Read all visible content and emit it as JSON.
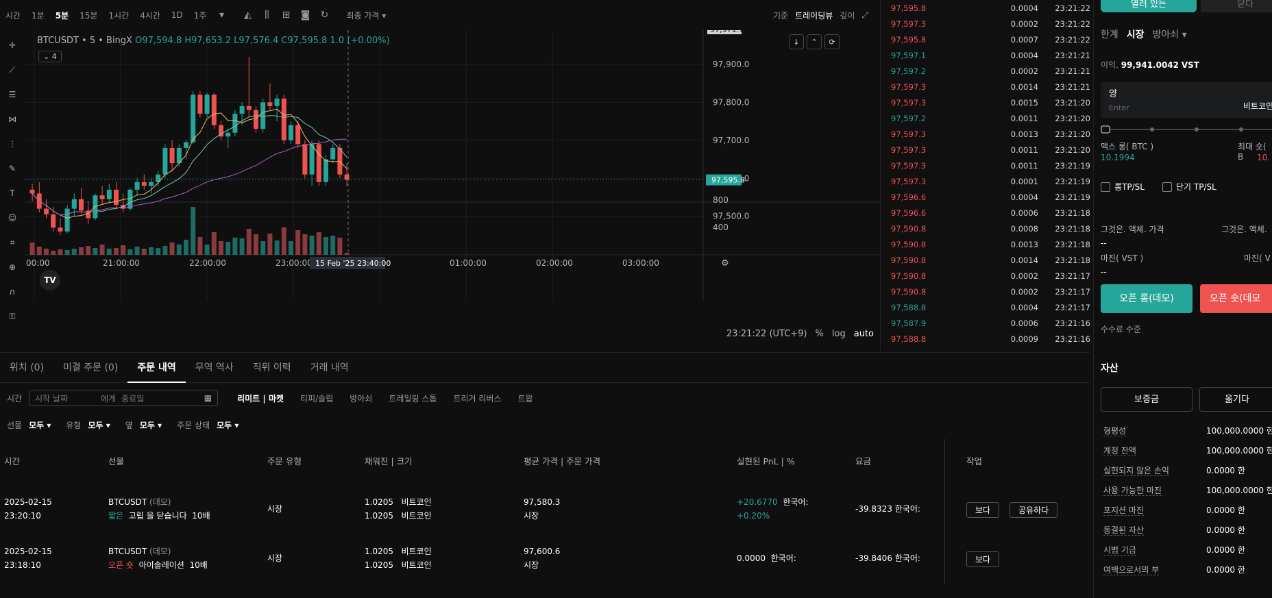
{
  "toolbar": {
    "intervals": [
      "시간",
      "1분",
      "5분",
      "15분",
      "1시간",
      "4시간",
      "1D",
      "1주"
    ],
    "active_interval": "5분",
    "price_type": "최종 가격 ▾",
    "basis_label": "기준",
    "view_tradingview": "트레이딩뷰",
    "view_depth": "깊이"
  },
  "legend": {
    "symbol": "BTCUSDT • 5 • BingX",
    "ohlc": "O97,594.8  H97,653.2  L97,576.4  C97,595.8  1.0 (+0.00%)",
    "indicator_count": "4"
  },
  "chart_data": {
    "type": "candlestick",
    "symbol": "BTCUSDT",
    "interval": "5분",
    "price_axis": [
      "97,900.0",
      "97,800.0",
      "97,700.0",
      "97,600.0",
      "97,500.0"
    ],
    "price_range": [
      97440,
      97990
    ],
    "last_price": "97,595.8",
    "top_price_label": "97,971.7",
    "volume_axis": [
      "800",
      "400"
    ],
    "time_labels": [
      "00:00",
      "21:00:00",
      "22:00:00",
      "23:00:00",
      "01:00:00",
      "02:00:00",
      "03:00:00"
    ],
    "cursor_label": "15 Feb '25   23:40:00",
    "candles": [
      [
        97570,
        97585,
        97540,
        97560
      ],
      [
        97560,
        97590,
        97510,
        97520
      ],
      [
        97520,
        97545,
        97495,
        97505
      ],
      [
        97505,
        97525,
        97460,
        97470
      ],
      [
        97470,
        97495,
        97450,
        97460
      ],
      [
        97460,
        97530,
        97455,
        97520
      ],
      [
        97520,
        97560,
        97500,
        97545
      ],
      [
        97545,
        97575,
        97505,
        97515
      ],
      [
        97515,
        97540,
        97480,
        97495
      ],
      [
        97495,
        97560,
        97490,
        97555
      ],
      [
        97555,
        97580,
        97530,
        97545
      ],
      [
        97545,
        97585,
        97535,
        97570
      ],
      [
        97570,
        97590,
        97520,
        97530
      ],
      [
        97530,
        97560,
        97510,
        97520
      ],
      [
        97520,
        97575,
        97515,
        97570
      ],
      [
        97570,
        97600,
        97555,
        97590
      ],
      [
        97590,
        97610,
        97570,
        97580
      ],
      [
        97580,
        97600,
        97560,
        97590
      ],
      [
        97590,
        97620,
        97580,
        97610
      ],
      [
        97610,
        97690,
        97600,
        97680
      ],
      [
        97680,
        97700,
        97620,
        97640
      ],
      [
        97640,
        97690,
        97630,
        97680
      ],
      [
        97680,
        97700,
        97650,
        97695
      ],
      [
        97695,
        97830,
        97690,
        97820
      ],
      [
        97820,
        97830,
        97760,
        97770
      ],
      [
        97770,
        97825,
        97760,
        97820
      ],
      [
        97820,
        97825,
        97730,
        97740
      ],
      [
        97740,
        97750,
        97700,
        97710
      ],
      [
        97710,
        97730,
        97680,
        97720
      ],
      [
        97720,
        97780,
        97710,
        97770
      ],
      [
        97770,
        97800,
        97740,
        97790
      ],
      [
        97790,
        97920,
        97760,
        97780
      ],
      [
        97780,
        97790,
        97720,
        97730
      ],
      [
        97730,
        97810,
        97720,
        97800
      ],
      [
        97800,
        97850,
        97780,
        97790
      ],
      [
        97790,
        97820,
        97750,
        97810
      ],
      [
        97810,
        97820,
        97690,
        97700
      ],
      [
        97700,
        97750,
        97690,
        97740
      ],
      [
        97740,
        97750,
        97680,
        97690
      ],
      [
        97690,
        97700,
        97600,
        97610
      ],
      [
        97610,
        97700,
        97580,
        97690
      ],
      [
        97690,
        97700,
        97580,
        97590
      ],
      [
        97590,
        97660,
        97580,
        97650
      ],
      [
        97650,
        97690,
        97640,
        97680
      ],
      [
        97680,
        97690,
        97600,
        97610
      ],
      [
        97610,
        97640,
        97580,
        97596
      ]
    ],
    "volumes": [
      180,
      120,
      90,
      60,
      80,
      70,
      90,
      110,
      130,
      100,
      150,
      90,
      100,
      140,
      80,
      120,
      90,
      110,
      100,
      130,
      180,
      150,
      220,
      700,
      260,
      150,
      330,
      200,
      190,
      250,
      240,
      380,
      300,
      200,
      310,
      210,
      400,
      200,
      360,
      300,
      280,
      330,
      260,
      280,
      250,
      30
    ]
  },
  "footer": {
    "time": "23:21:22 (UTC+9)",
    "pct": "%",
    "log": "log",
    "auto": "auto"
  },
  "trades": [
    {
      "price": "97,595.8",
      "qty": "0.0004",
      "time": "23:21:22",
      "side": "sell"
    },
    {
      "price": "97,597.3",
      "qty": "0.0002",
      "time": "23:21:22",
      "side": "sell"
    },
    {
      "price": "97,595.8",
      "qty": "0.0007",
      "time": "23:21:22",
      "side": "sell"
    },
    {
      "price": "97,597.1",
      "qty": "0.0004",
      "time": "23:21:21",
      "side": "buy"
    },
    {
      "price": "97,597.2",
      "qty": "0.0002",
      "time": "23:21:21",
      "side": "buy"
    },
    {
      "price": "97,597.3",
      "qty": "0.0014",
      "time": "23:21:21",
      "side": "sell"
    },
    {
      "price": "97,597.3",
      "qty": "0.0015",
      "time": "23:21:20",
      "side": "sell"
    },
    {
      "price": "97,597.2",
      "qty": "0.0011",
      "time": "23:21:20",
      "side": "buy"
    },
    {
      "price": "97,597.3",
      "qty": "0.0013",
      "time": "23:21:20",
      "side": "sell"
    },
    {
      "price": "97,597.3",
      "qty": "0.0011",
      "time": "23:21:20",
      "side": "sell"
    },
    {
      "price": "97,597.3",
      "qty": "0.0011",
      "time": "23:21:19",
      "side": "sell"
    },
    {
      "price": "97,597.3",
      "qty": "0.0001",
      "time": "23:21:19",
      "side": "sell"
    },
    {
      "price": "97,596.6",
      "qty": "0.0004",
      "time": "23:21:19",
      "side": "sell"
    },
    {
      "price": "97,596.6",
      "qty": "0.0006",
      "time": "23:21:18",
      "side": "sell"
    },
    {
      "price": "97,590.8",
      "qty": "0.0008",
      "time": "23:21:18",
      "side": "sell"
    },
    {
      "price": "97,590.8",
      "qty": "0.0013",
      "time": "23:21:18",
      "side": "sell"
    },
    {
      "price": "97,590.8",
      "qty": "0.0014",
      "time": "23:21:18",
      "side": "sell"
    },
    {
      "price": "97,590.8",
      "qty": "0.0002",
      "time": "23:21:17",
      "side": "sell"
    },
    {
      "price": "97,590.8",
      "qty": "0.0002",
      "time": "23:21:17",
      "side": "sell"
    },
    {
      "price": "97,588.8",
      "qty": "0.0004",
      "time": "23:21:17",
      "side": "buy"
    },
    {
      "price": "97,587.9",
      "qty": "0.0006",
      "time": "23:21:16",
      "side": "buy"
    },
    {
      "price": "97,588.8",
      "qty": "0.0009",
      "time": "23:21:16",
      "side": "sell"
    }
  ],
  "orders_panel": {
    "tabs": [
      "위치 (0)",
      "미결 주문 (0)",
      "주문 내역",
      "무역 역사",
      "직위 이력",
      "거래 내역"
    ],
    "time_label": "시간",
    "date_start": "시작 날짜",
    "date_sep": "에게",
    "date_end": "종료일",
    "order_types": [
      "리미트 | 마켓",
      "티피/슬립",
      "방아쇠",
      "트레일링 스톱",
      "트리거 리버스",
      "트왑"
    ],
    "filters": [
      {
        "label": "선물",
        "value": "모두 ▾"
      },
      {
        "label": "유형",
        "value": "모두 ▾"
      },
      {
        "label": "옆",
        "value": "모두 ▾"
      },
      {
        "label": "주문 상태",
        "value": "모두 ▾"
      }
    ],
    "headers": [
      "시간",
      "선물",
      "주문 유형",
      "채워진 | 크기",
      "평균 가격 | 주문 가격",
      "실현된 PnL | %",
      "요금",
      "작업"
    ],
    "rows": [
      {
        "date": "2025-02-15",
        "time": "23:20:10",
        "symbol": "BTCUSDT",
        "demo": "(데모)",
        "side": "짧은",
        "side_color": "#26a69a",
        "action": "고립 을 닫습니다",
        "leverage": "10배",
        "type": "시장",
        "fill1": "1.0205",
        "unit1": "비트코인",
        "fill2": "1.0205",
        "unit2": "비트코인",
        "avg": "97,580.3",
        "ord": "시장",
        "pnl": "+20.6770",
        "pnl_unit": "한국어:",
        "pnl_pct": "+0.20%",
        "pnl_color": "#26a69a",
        "fee": "-39.8323 한국어:",
        "btn_view": "보다",
        "btn_share": "공유하다"
      },
      {
        "date": "2025-02-15",
        "time": "23:18:10",
        "symbol": "BTCUSDT",
        "demo": "(데모)",
        "side": "오픈 숏",
        "side_color": "#ef5350",
        "action": "아이솔레이션",
        "leverage": "10배",
        "type": "시장",
        "fill1": "1.0205",
        "unit1": "비트코인",
        "fill2": "1.0205",
        "unit2": "비트코인",
        "avg": "97,600.6",
        "ord": "시장",
        "pnl": "0.0000",
        "pnl_unit": "한국어:",
        "pnl_pct": "",
        "pnl_color": "#ffffff",
        "fee": "-39.8406 한국어:",
        "btn_view": "보다"
      }
    ]
  },
  "order_form": {
    "top_btn_left": "열려 있는",
    "top_btn_right": "닫다",
    "mode_tabs": [
      "한계",
      "시장",
      "방아쇠 ▾"
    ],
    "active_mode": "시장",
    "available_label": "이익.",
    "available_value": "99,941.0042",
    "available_unit": "VST",
    "qty_label": "양",
    "qty_placeholder": "Enter",
    "qty_unit": "비트코인",
    "max_long_label": "맥스 롱( BTC )",
    "max_long_value": "10.1994",
    "max_short_label": "최대 숏( B",
    "max_short_value": "10.",
    "tp_long": "롱TP/SL",
    "tp_short": "단기 TP/SL",
    "liq_left": "그것은. 액체. 가격",
    "liq_right": "그것은. 액체.",
    "dash": "--",
    "margin_left": "마진( VST )",
    "margin_right": "마진( V",
    "open_long": "오픈 롱(데모)",
    "open_short": "오픈 숏(데모",
    "fee_level": "수수료 수준"
  },
  "assets": {
    "title": "자산",
    "btn_deposit": "보증금",
    "btn_transfer": "옮기다",
    "rows": [
      {
        "k": "형평성",
        "v": "100,000.0000 한"
      },
      {
        "k": "계정 잔액",
        "v": "100,000.0000 한"
      },
      {
        "k": "실현되지 않은 손익",
        "v": "0.0000 한"
      },
      {
        "k": "사용 가능한 마진",
        "v": "100,000.0000 한"
      },
      {
        "k": "포지션 마진",
        "v": "0.0000 한"
      },
      {
        "k": "동결된 자산",
        "v": "0.0000 한"
      },
      {
        "k": "시범 기금",
        "v": "0.0000 한"
      },
      {
        "k": "여백으로서의 부",
        "v": "0.0000 한"
      }
    ]
  },
  "colors": {
    "up": "#26a69a",
    "down": "#ef5350",
    "bg": "#0f0f10"
  }
}
